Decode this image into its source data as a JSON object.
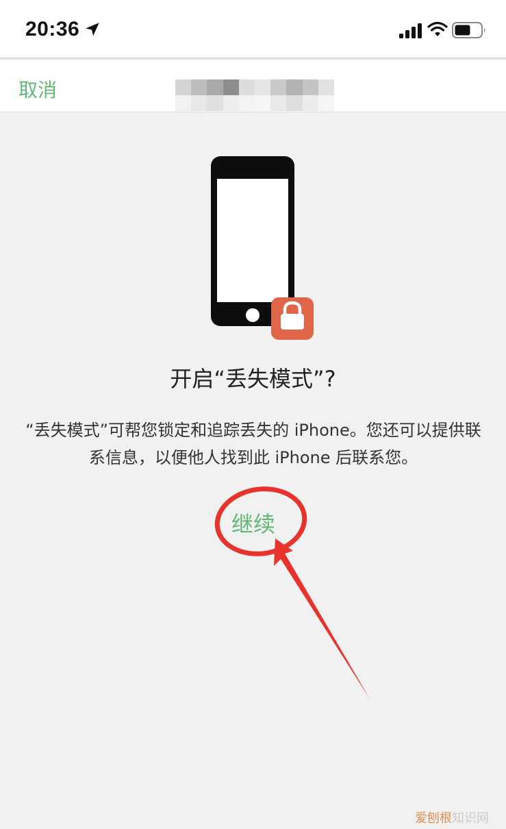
{
  "status_bar": {
    "time": "20:36",
    "icons": [
      "location-arrow-icon",
      "cellular-signal-icon",
      "wifi-icon",
      "battery-icon"
    ]
  },
  "nav": {
    "cancel_label": "取消",
    "title_obscured": true
  },
  "illustration": {
    "icon": "iphone-lock-icon",
    "lock_badge_color": "#e0664a"
  },
  "dialog": {
    "heading": "开启“丢失模式”?",
    "description": "“丢失模式”可帮您锁定和追踪丢失的 iPhone。您还可以提供联系信息，以便他人找到此 iPhone 后联系您。",
    "continue_label": "继续"
  },
  "annotation": {
    "color": "#e8322c",
    "shapes": [
      "circle",
      "arrow"
    ]
  },
  "watermark": {
    "brand": "爱刨根",
    "suffix": "知识网"
  },
  "colors": {
    "accent": "#5fb873",
    "background": "#f2f1f2"
  }
}
